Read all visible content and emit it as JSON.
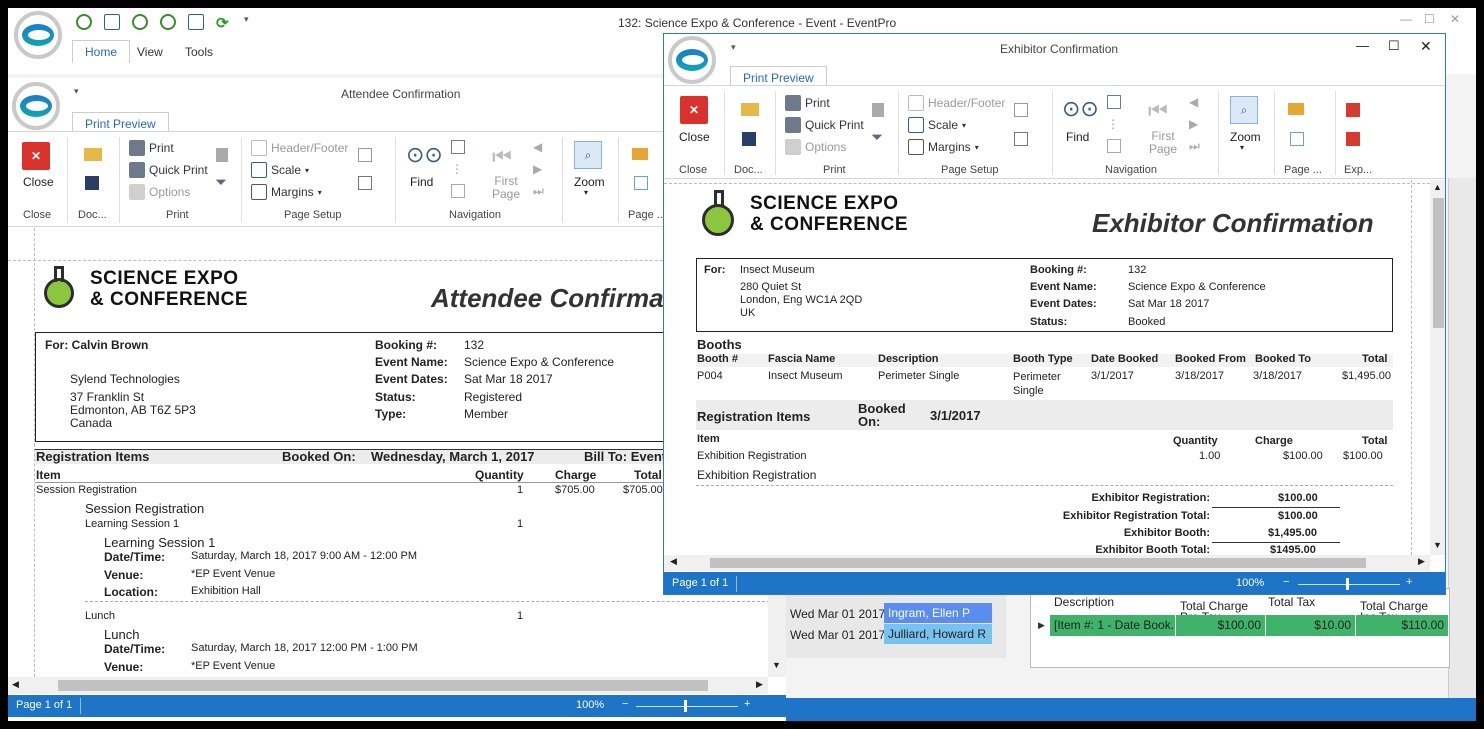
{
  "main_window": {
    "title": "132: Science Expo & Conference - Event - EventPro",
    "tabs": [
      "Home",
      "View",
      "Tools"
    ]
  },
  "attendee": {
    "title": "Attendee Confirmation",
    "ribbon_tab": "Print Preview",
    "buttons": {
      "close": "Close",
      "print": "Print",
      "quick_print": "Quick Print",
      "options": "Options",
      "header_footer": "Header/Footer",
      "scale": "Scale",
      "margins": "Margins",
      "find": "Find",
      "first_page": "First Page",
      "zoom": "Zoom"
    },
    "groups": {
      "close": "Close",
      "doc": "Doc...",
      "print": "Print",
      "page_setup": "Page Setup",
      "navigation": "Navigation",
      "page": "Page ..."
    },
    "status_page": "Page 1 of 1",
    "status_zoom": "100%",
    "report": {
      "logo_line1": "SCIENCE EXPO",
      "logo_line2": "& CONFERENCE",
      "heading": "Attendee Confirmation",
      "for_label": "For:",
      "for_name": "Calvin Brown",
      "company": "Sylend Technologies",
      "address1": "37 Franklin St",
      "address2": "Edmonton, AB T6Z 5P3",
      "country": "Canada",
      "booking_label": "Booking #:",
      "booking_value": "132",
      "event_name_label": "Event Name:",
      "event_name_value": "Science Expo & Conference",
      "event_dates_label": "Event Dates:",
      "event_dates_value": "Sat Mar 18 2017",
      "status_label": "Status:",
      "status_value": "Registered",
      "type_label": "Type:",
      "type_value": "Member",
      "reg_items": "Registration Items",
      "booked_on_label": "Booked On:",
      "booked_on_value": "Wednesday, March 1, 2017",
      "bill_to": "Bill To: Event",
      "col_item": "Item",
      "col_qty": "Quantity",
      "col_charge": "Charge",
      "col_total": "Total",
      "row1_item": "Session Registration",
      "row1_qty": "1",
      "row1_charge": "$705.00",
      "row1_total": "$705.00",
      "session_reg": "Session Registration",
      "learning_row": "Learning Session 1",
      "learning_qty": "1",
      "learning_title": "Learning Session 1",
      "datetime_label": "Date/Time:",
      "datetime1": "Saturday, March 18, 2017 9:00 AM - 12:00 PM",
      "venue_label": "Venue:",
      "venue1": "*EP Event Venue",
      "location_label": "Location:",
      "location1": "Exhibition Hall",
      "lunch_row": "Lunch",
      "lunch_qty": "1",
      "lunch_title": "Lunch",
      "datetime2": "Saturday, March 18, 2017 12:00 PM - 1:00 PM",
      "venue2": "*EP Event Venue"
    }
  },
  "exhibitor": {
    "title": "Exhibitor Confirmation",
    "ribbon_tab": "Print Preview",
    "buttons": {
      "close": "Close",
      "print": "Print",
      "quick_print": "Quick Print",
      "options": "Options",
      "header_footer": "Header/Footer",
      "scale": "Scale",
      "margins": "Margins",
      "find": "Find",
      "first_page": "First Page",
      "zoom": "Zoom"
    },
    "groups": {
      "close": "Close",
      "doc": "Doc...",
      "print": "Print",
      "page_setup": "Page Setup",
      "navigation": "Navigation",
      "page": "Page ...",
      "export": "Exp..."
    },
    "status_page": "Page 1 of 1",
    "status_zoom": "100%",
    "report": {
      "logo_line1": "SCIENCE EXPO",
      "logo_line2": "& CONFERENCE",
      "heading": "Exhibitor Confirmation",
      "for_label": "For:",
      "for_name": "Insect Museum",
      "address1": "280 Quiet St",
      "address2": "London, Eng WC1A 2QD",
      "country": "UK",
      "booking_label": "Booking #:",
      "booking_value": "132",
      "event_name_label": "Event Name:",
      "event_name_value": "Science Expo & Conference",
      "event_dates_label": "Event Dates:",
      "event_dates_value": "Sat Mar 18 2017",
      "status_label": "Status:",
      "status_value": "Booked",
      "booths": "Booths",
      "booth_cols": [
        "Booth #",
        "Fascia Name",
        "Description",
        "Booth Type",
        "Date Booked",
        "Booked From",
        "Booked To",
        "Total"
      ],
      "booth_row": [
        "P004",
        "Insect Museum",
        "Perimeter Single",
        "Perimeter Single",
        "3/1/2017",
        "3/18/2017",
        "3/18/2017",
        "$1,495.00"
      ],
      "reg_items": "Registration Items",
      "booked_on_label": "Booked On:",
      "booked_on_value": "3/1/2017",
      "col_item": "Item",
      "col_qty": "Quantity",
      "col_charge": "Charge",
      "col_total": "Total",
      "reg_row": [
        "Exhibition Registration",
        "1.00",
        "$100.00",
        "$100.00"
      ],
      "exhibition_reg": "Exhibition  Registration",
      "sum1_label": "Exhibitor Registration:",
      "sum1_value": "$100.00",
      "sum2_label": "Exhibitor Registration Total:",
      "sum2_value": "$100.00",
      "sum3_label": "Exhibitor Booth:",
      "sum3_value": "$1,495.00",
      "sum4_label": "Exhibitor Booth Total:",
      "sum4_value": "$1495.00"
    }
  },
  "background_grid": {
    "rows": [
      {
        "date": "Wed Mar 01 2017",
        "name": "Ingram, Ellen P"
      },
      {
        "date": "Wed Mar 01 2017",
        "name": "Julliard, Howard R"
      }
    ],
    "cols": [
      "Description",
      "Total Charge Pre Tax",
      "Total Tax",
      "Total Charge Inc Tax"
    ],
    "item_row": [
      "[Item #: 1 - Date Book...",
      "$100.00",
      "$10.00",
      "$110.00"
    ]
  }
}
